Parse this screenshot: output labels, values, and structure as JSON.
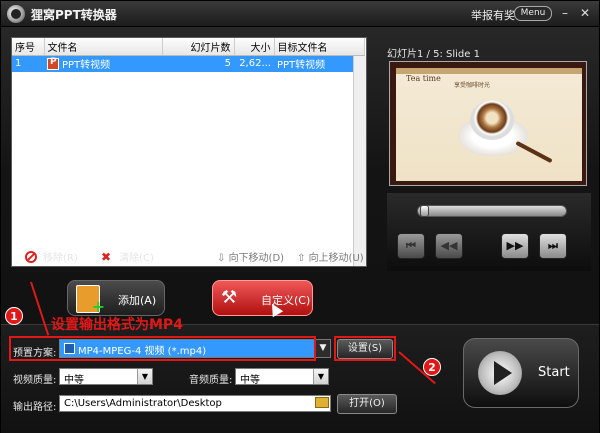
{
  "app": {
    "title": "狸窝PPT转换器",
    "report": "举报有奖",
    "menu_label": "Menu"
  },
  "file_list": {
    "columns": [
      "序号",
      "文件名",
      "幻灯片数",
      "大小",
      "目标文件名"
    ],
    "rows": [
      {
        "index": "1",
        "name": "PPT转视频",
        "slides": "5",
        "size": "2,62...",
        "target": "PPT转视频"
      }
    ]
  },
  "list_actions": {
    "remove": "移除(R)",
    "clear": "清除(C)",
    "move_down": "向下移动(D)",
    "move_up": "向上移动(U)"
  },
  "preview": {
    "label": "幻灯片1 / 5: Slide 1",
    "slide_title": "Tea time",
    "slide_tagline": "享受咖啡时光"
  },
  "buttons": {
    "add": "添加(A)",
    "custom": "自定义(C)",
    "settings": "设置(S)",
    "open": "打开(O)",
    "start": "Start"
  },
  "settings": {
    "preset_label": "预置方案:",
    "preset_value": "MP4-MPEG-4 视频 (*.mp4)",
    "video_quality_label": "视频质量:",
    "video_quality_value": "中等",
    "audio_quality_label": "音频质量:",
    "audio_quality_value": "中等",
    "output_path_label": "输出路径:",
    "output_path_value": "C:\\Users\\Administrator\\Desktop"
  },
  "annotations": {
    "step1_num": "1",
    "step1_text": "设置输出格式为MP4",
    "step2_num": "2"
  },
  "colors": {
    "accent_red": "#e01818",
    "selection_blue": "#3399ff"
  }
}
